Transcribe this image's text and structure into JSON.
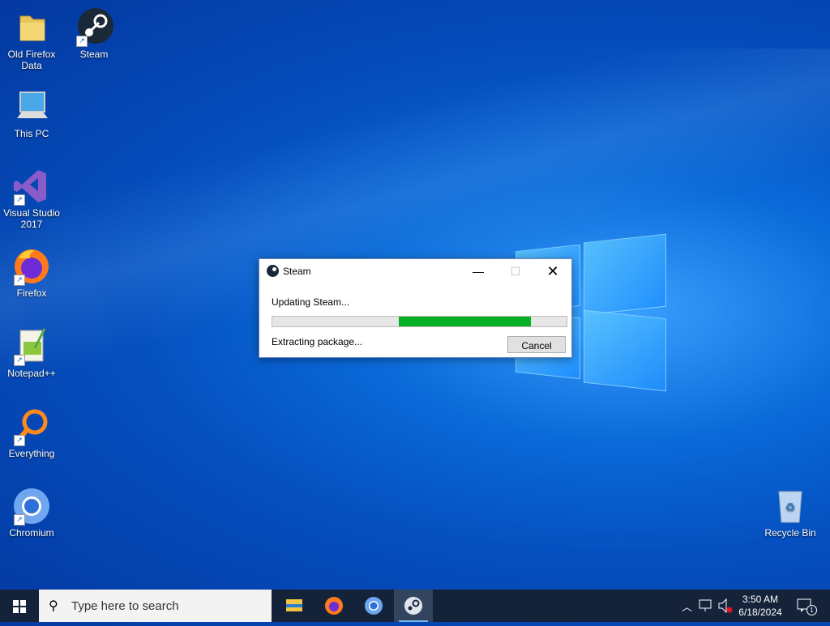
{
  "desktop": {
    "icons": [
      {
        "label": "Old Firefox Data",
        "icon": "folder-icon"
      },
      {
        "label": "Steam",
        "icon": "steam-icon"
      },
      {
        "label": "This PC",
        "icon": "computer-icon"
      },
      {
        "label": "Visual Studio 2017",
        "icon": "visual-studio-icon"
      },
      {
        "label": "Firefox",
        "icon": "firefox-icon"
      },
      {
        "label": "Notepad++",
        "icon": "notepadpp-icon"
      },
      {
        "label": "Everything",
        "icon": "everything-icon"
      },
      {
        "label": "Chromium",
        "icon": "chromium-icon"
      },
      {
        "label": "Recycle Bin",
        "icon": "recycle-bin-icon"
      }
    ]
  },
  "dialog": {
    "title": "Steam",
    "status": "Updating Steam...",
    "progress": 0.56,
    "progress_start": 0.43,
    "substatus": "Extracting package...",
    "cancel_label": "Cancel",
    "minimize_glyph": "—",
    "maximize_glyph": "☐",
    "close_glyph": "✕"
  },
  "taskbar": {
    "search_placeholder": "Type here to search",
    "apps": [
      "file-explorer-icon",
      "firefox-icon",
      "chromium-icon",
      "steam-icon"
    ],
    "time": "3:50 AM",
    "date": "6/18/2024",
    "notification_count": "1"
  },
  "colors": {
    "progress_fill": "#06b025",
    "taskbar": "#14233a"
  }
}
